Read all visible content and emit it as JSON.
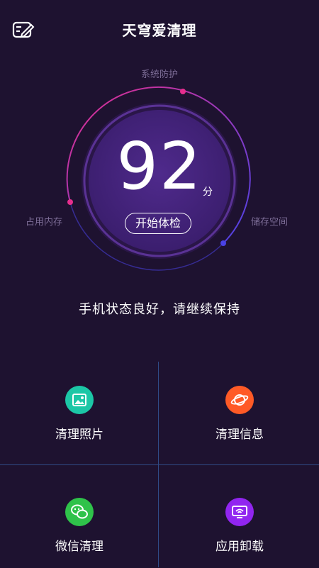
{
  "header": {
    "title": "天穹爱清理",
    "menu_icon": "edit-note-icon"
  },
  "gauge": {
    "score": "92",
    "unit": "分",
    "score_fraction": 0.92,
    "button_label": "开始体检",
    "labels": {
      "top": "系统防护",
      "left": "占用内存",
      "right": "储存空间"
    },
    "colors": {
      "arc_start": "#e62e8e",
      "arc_end": "#4a42e6",
      "inner": "#4a2585"
    }
  },
  "status": "手机状态良好，请继续保持",
  "tiles": [
    {
      "label": "清理照片",
      "icon": "photo-icon",
      "color": "#1cc7a6"
    },
    {
      "label": "清理信息",
      "icon": "planet-icon",
      "color": "#ff5a26"
    },
    {
      "label": "微信清理",
      "icon": "wechat-icon",
      "color": "#2fc24a"
    },
    {
      "label": "应用卸载",
      "icon": "uninstall-icon",
      "color": "#9125f0"
    }
  ]
}
